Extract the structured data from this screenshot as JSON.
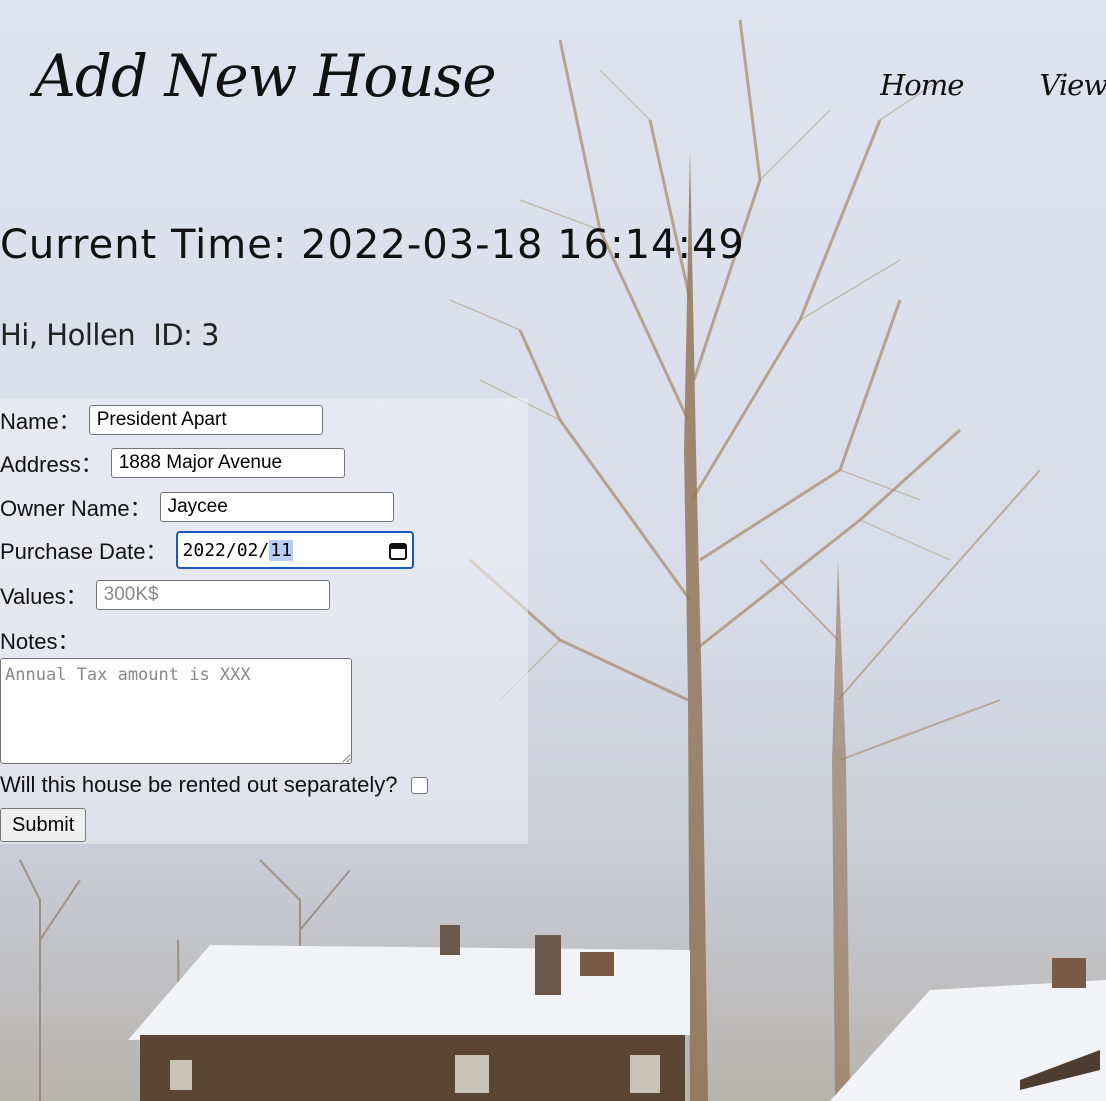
{
  "header": {
    "title": "Add New House",
    "nav": [
      {
        "label": "Home"
      },
      {
        "label": "View"
      }
    ]
  },
  "clock": {
    "text": "Current Time: 2022-03-18 16:14:49"
  },
  "user": {
    "greeting": "Hi, Hollen",
    "id_label": "ID: 3"
  },
  "form": {
    "name": {
      "label": "Name：",
      "value": "President Apart"
    },
    "address": {
      "label": "Address：",
      "value": "1888 Major Avenue"
    },
    "owner": {
      "label": "Owner Name：",
      "value": "Jaycee"
    },
    "purchase_date": {
      "label": "Purchase Date：",
      "value_prefix": "2022/02/",
      "value_highlight": "11"
    },
    "values": {
      "label": "Values：",
      "placeholder": "300K$"
    },
    "notes": {
      "label": "Notes：",
      "placeholder": "Annual Tax amount is XXX"
    },
    "rented": {
      "label": "Will this house be rented out separately?"
    },
    "submit_label": "Submit"
  },
  "colors": {
    "focus_ring": "#1a57c7",
    "text": "#111111"
  },
  "icons": {
    "calendar": "calendar-icon"
  }
}
